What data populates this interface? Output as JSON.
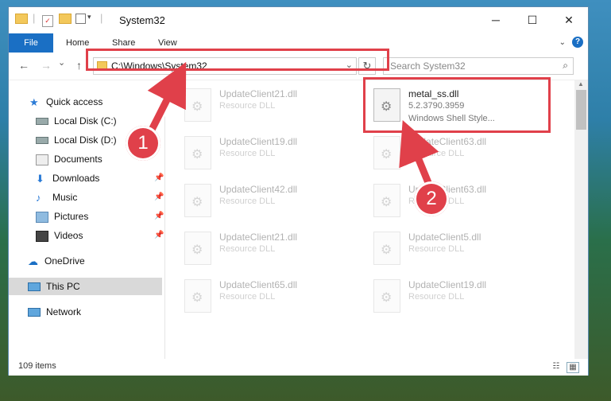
{
  "window": {
    "title": "System32",
    "controls": {
      "minimize": "─",
      "maximize": "☐",
      "close": "✕"
    }
  },
  "quick_access_toolbar": {
    "dropdown": "▾"
  },
  "ribbon": {
    "tabs": [
      "File",
      "Home",
      "Share",
      "View"
    ],
    "help": "?"
  },
  "nav": {
    "back": "←",
    "forward": "→",
    "recent": "⌄",
    "up": "↑",
    "address_path": "C:\\Windows\\System32",
    "address_dropdown": "⌄",
    "refresh": "↻",
    "search_placeholder": "Search System32",
    "search_icon": "⌕"
  },
  "sidebar": {
    "items": [
      {
        "label": "Quick access",
        "icon": "star-icon"
      },
      {
        "label": "Local Disk (C:)",
        "icon": "drive-icon"
      },
      {
        "label": "Local Disk (D:)",
        "icon": "drive-icon"
      },
      {
        "label": "Documents",
        "icon": "documents-icon"
      },
      {
        "label": "Downloads",
        "icon": "download-icon"
      },
      {
        "label": "Music",
        "icon": "music-icon"
      },
      {
        "label": "Pictures",
        "icon": "pictures-icon"
      },
      {
        "label": "Videos",
        "icon": "videos-icon"
      },
      {
        "label": "OneDrive",
        "icon": "cloud-icon"
      },
      {
        "label": "This PC",
        "icon": "computer-icon"
      },
      {
        "label": "Network",
        "icon": "network-icon"
      }
    ],
    "pin": "📌"
  },
  "files": [
    {
      "name": "UpdateClient21.dll",
      "type": "Resource DLL",
      "extra": ""
    },
    {
      "name": "metal_ss.dll",
      "type": "5.2.3790.3959",
      "extra": "Windows Shell Style..."
    },
    {
      "name": "UpdateClient19.dll",
      "type": "Resource DLL",
      "extra": ""
    },
    {
      "name": "UpdateClient63.dll",
      "type": "Resource DLL",
      "extra": ""
    },
    {
      "name": "UpdateClient42.dll",
      "type": "Resource DLL",
      "extra": ""
    },
    {
      "name": "UpdateClient63.dll",
      "type": "Resource DLL",
      "extra": ""
    },
    {
      "name": "UpdateClient21.dll",
      "type": "Resource DLL",
      "extra": ""
    },
    {
      "name": "UpdateClient5.dll",
      "type": "Resource DLL",
      "extra": ""
    },
    {
      "name": "UpdateClient65.dll",
      "type": "Resource DLL",
      "extra": ""
    },
    {
      "name": "UpdateClient19.dll",
      "type": "Resource DLL",
      "extra": ""
    }
  ],
  "status": {
    "items_count": "109 items",
    "details_view": "☷",
    "large_icons_view": "▦"
  },
  "annotations": {
    "step1": "1",
    "step2": "2"
  },
  "colors": {
    "highlight": "#e0404a",
    "accent": "#1a6fc4"
  }
}
